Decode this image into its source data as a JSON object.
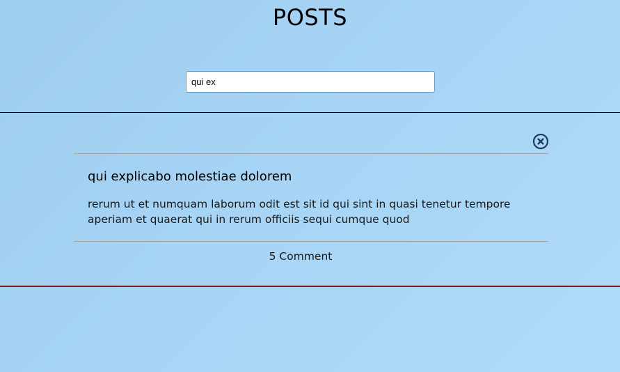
{
  "header": {
    "title": "POSTS"
  },
  "search": {
    "value": "qui ex",
    "placeholder": ""
  },
  "posts": [
    {
      "title": "qui explicabo molestiae dolorem",
      "body": "rerum ut et numquam laborum odit est sit id qui sint in quasi tenetur tempore aperiam et quaerat qui in rerum officiis sequi cumque quod",
      "comments_label": "5 Comment",
      "close_icon": "close-circle-icon"
    }
  ],
  "colors": {
    "background": "#a8d5f5",
    "close_icon": "#1f3b5a",
    "bottom_divider": "#7a1b1b"
  }
}
